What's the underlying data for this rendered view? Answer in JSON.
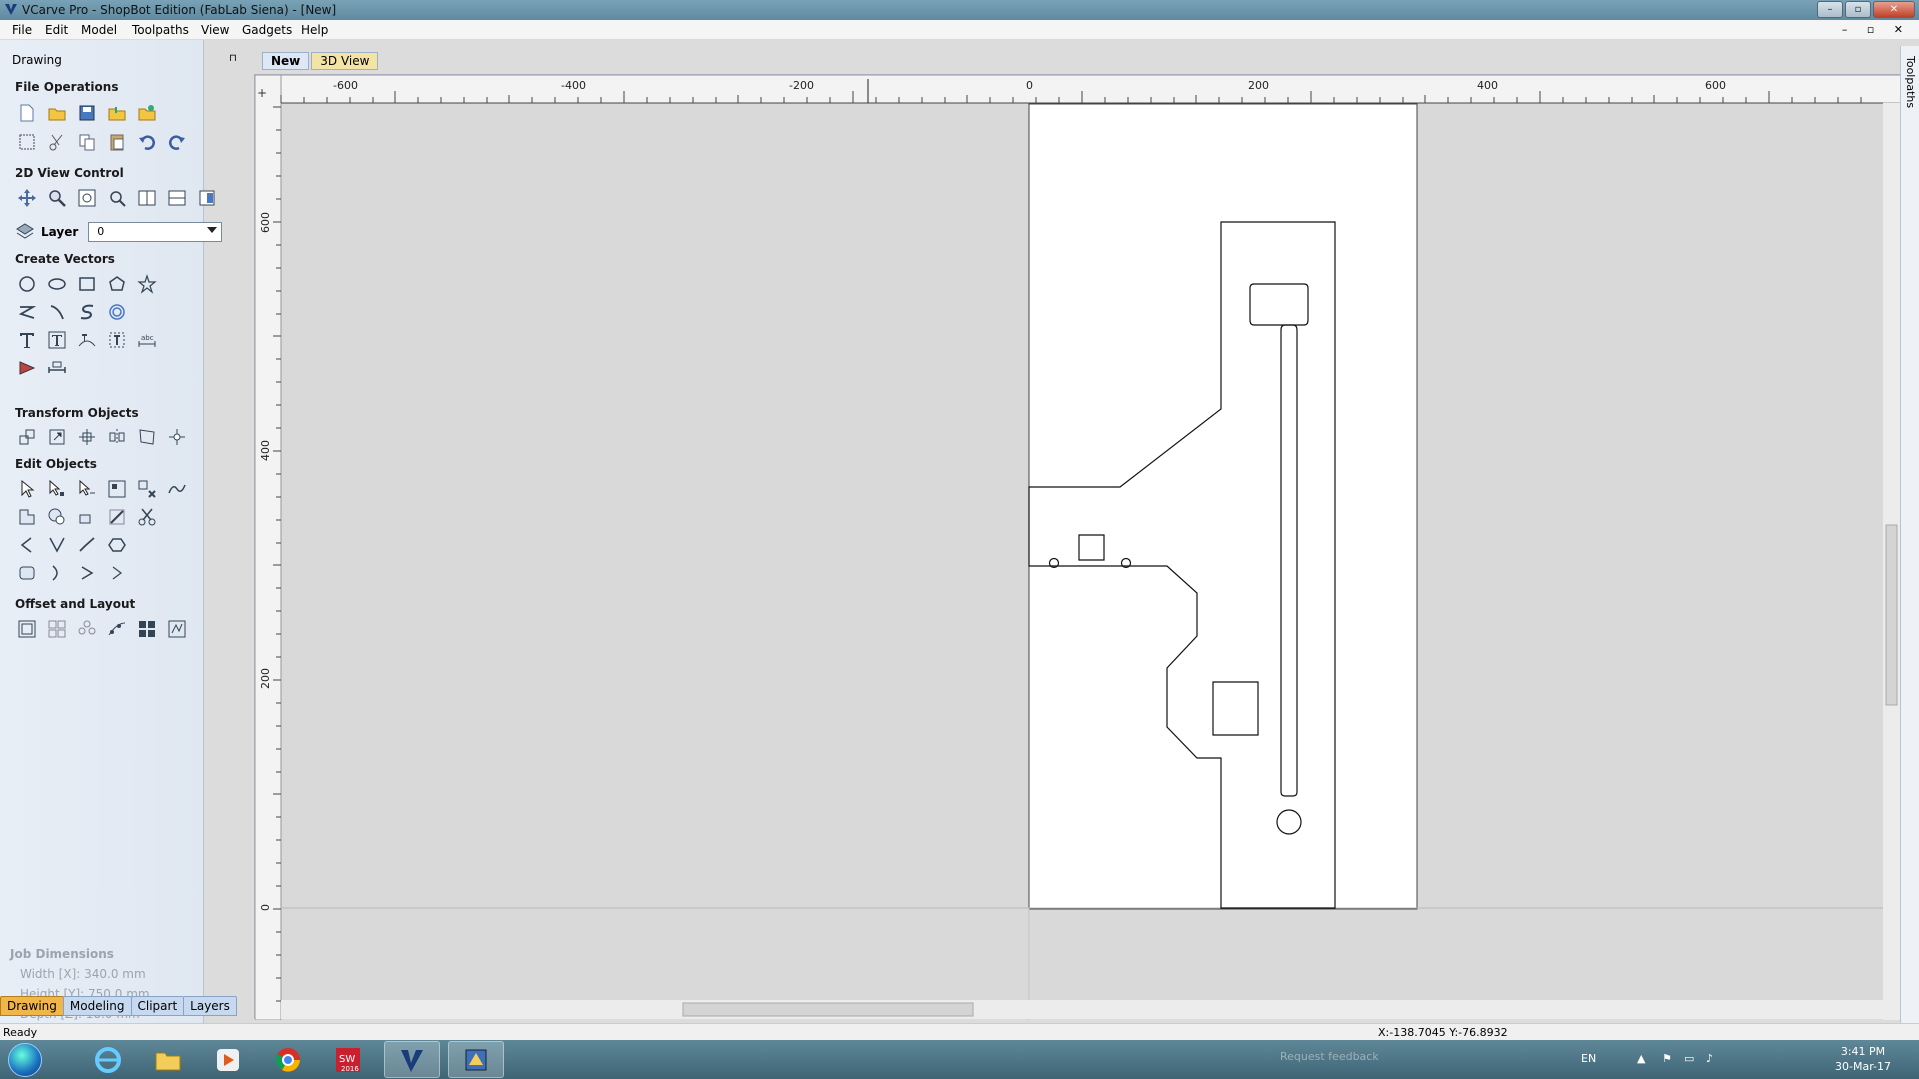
{
  "window": {
    "title": "VCarve Pro - ShopBot Edition (FabLab Siena) - [New]",
    "controls": {
      "minimize": "–",
      "maximize": "▫",
      "close": "✕"
    }
  },
  "menu": [
    "File",
    "Edit",
    "Model",
    "Toolpaths",
    "View",
    "Gadgets",
    "Help"
  ],
  "mdi_controls": "– ▫ ✕",
  "panel": {
    "header": "Drawing",
    "pin": "⊓",
    "sections": {
      "file_operations": "File Operations",
      "view_control": "2D View Control",
      "layer_label": "Layer",
      "layer_value": "0",
      "create_vectors": "Create Vectors",
      "transform_objects": "Transform Objects",
      "edit_objects": "Edit Objects",
      "offset_layout": "Offset and Layout"
    },
    "job_dimensions": {
      "title": "Job Dimensions",
      "width": "Width  [X]: 340.0 mm",
      "height": "Height [Y]: 750.0 mm",
      "depth": "Depth  [Z]: 18.0 mm"
    },
    "bottom_tabs": [
      "Drawing",
      "Modeling",
      "Clipart",
      "Layers"
    ]
  },
  "doc_tabs": [
    "New",
    "3D View"
  ],
  "ruler": {
    "x_labels": [
      "-600",
      "-400",
      "-200",
      "0",
      "200",
      "400",
      "600"
    ],
    "y_labels": [
      "600",
      "400",
      "200",
      "0"
    ]
  },
  "right_panel_label": "Toolpaths",
  "status": {
    "left": "Ready",
    "coords": "X:-138.7045 Y:-76.8932"
  },
  "taskbar": {
    "apps": [
      "windows-explorer",
      "internet-explorer",
      "file-explorer",
      "media-player",
      "chrome",
      "solidworks-2016",
      "vcarve",
      "vcarve-project"
    ],
    "sw_label": "2016",
    "lang": "EN",
    "time": "3:41 PM",
    "date": "30-Mar-17",
    "feedback": "Request feedback"
  }
}
